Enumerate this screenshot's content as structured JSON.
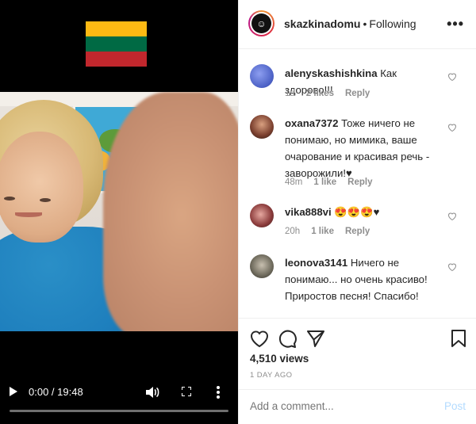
{
  "video": {
    "time_display": "0:00 / 19:48",
    "progress_fraction": 0.0,
    "flag_colors": [
      "#fdb913",
      "#006a44",
      "#c1272d"
    ]
  },
  "post": {
    "username": "skazkinadomu",
    "separator": "•",
    "follow_status": "Following",
    "options_label": "•••"
  },
  "comments": [
    {
      "user": "alenyskashishkina",
      "text": "Как здорово!!!",
      "time": "1d",
      "likes": "2 likes",
      "reply": "Reply"
    },
    {
      "user": "oxana7372",
      "text": "Тоже ничего не понимаю, но мимика, ваше очарование и красивая речь - заворожили!♥",
      "time": "48m",
      "likes": "1 like",
      "reply": "Reply"
    },
    {
      "user": "vika888vi",
      "text": "😍😍😍♥",
      "time": "20h",
      "likes": "1 like",
      "reply": "Reply"
    },
    {
      "user": "leonova3141",
      "text": "Ничего не понимаю... но очень красиво! Приростов песня! Спасибо!",
      "time": "",
      "likes": "",
      "reply": ""
    }
  ],
  "stats": {
    "views": "4,510 views",
    "posted": "1 DAY AGO"
  },
  "add_comment": {
    "placeholder": "Add a comment...",
    "post_label": "Post"
  }
}
